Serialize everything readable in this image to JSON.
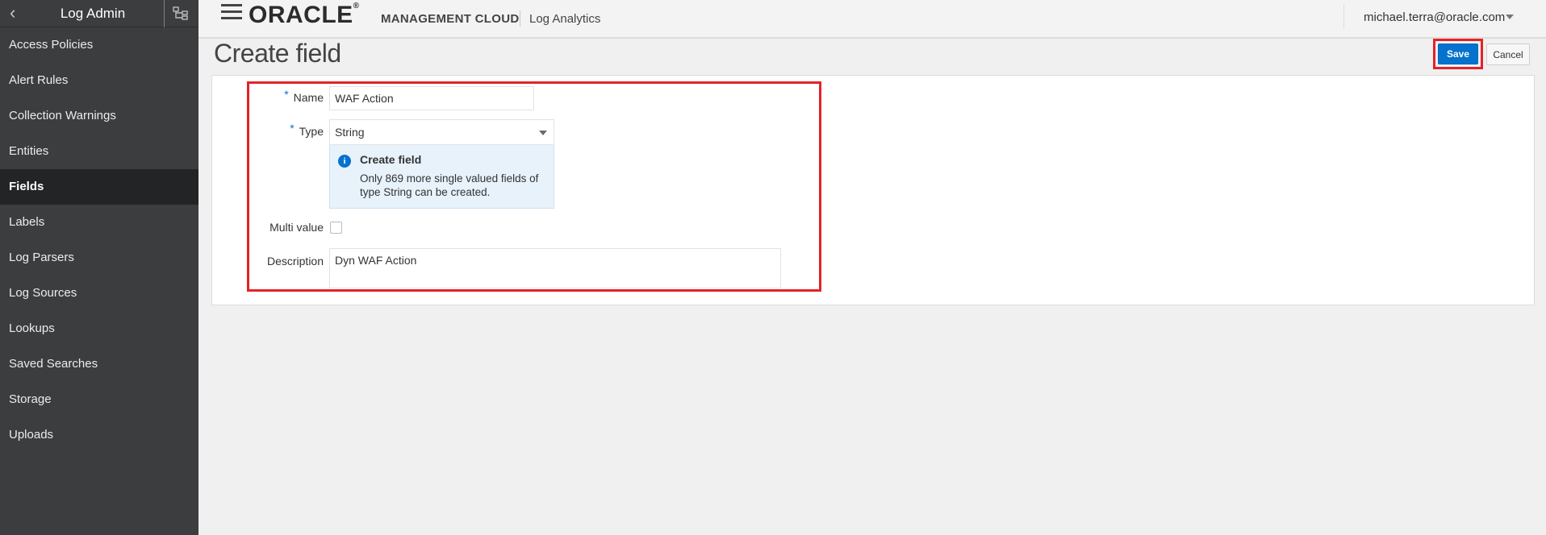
{
  "sidebar": {
    "title": "Log Admin",
    "items": [
      {
        "label": "Access Policies"
      },
      {
        "label": "Alert Rules"
      },
      {
        "label": "Collection Warnings"
      },
      {
        "label": "Entities"
      },
      {
        "label": "Fields",
        "active": true
      },
      {
        "label": "Labels"
      },
      {
        "label": "Log Parsers"
      },
      {
        "label": "Log Sources"
      },
      {
        "label": "Lookups"
      },
      {
        "label": "Saved Searches"
      },
      {
        "label": "Storage"
      },
      {
        "label": "Uploads"
      }
    ]
  },
  "header": {
    "brand": "ORACLE",
    "product": "MANAGEMENT CLOUD",
    "app": "Log Analytics",
    "user": "michael.terra@oracle.com"
  },
  "page": {
    "title": "Create field",
    "save_label": "Save",
    "cancel_label": "Cancel"
  },
  "form": {
    "required_marker": "*",
    "name_label": "Name",
    "name_value": "WAF Action",
    "type_label": "Type",
    "type_value": "String",
    "info_title": "Create field",
    "info_text": "Only 869 more single valued fields of type String can be created.",
    "multi_label": "Multi value",
    "multi_checked": false,
    "desc_label": "Description",
    "desc_value": "Dyn WAF Action"
  },
  "colors": {
    "accent": "#0572ce",
    "highlight": "#e52227",
    "sidebar_bg": "#3c3d3f"
  }
}
